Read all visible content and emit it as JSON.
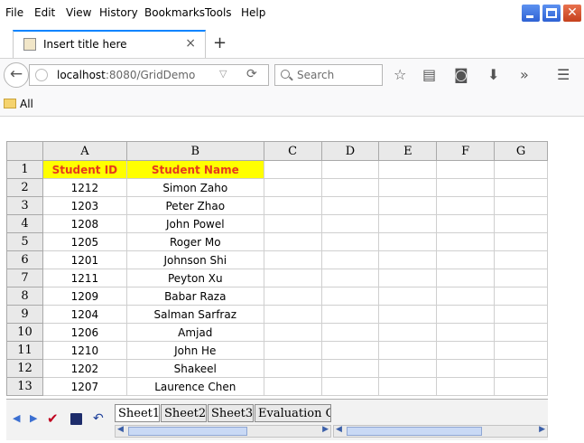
{
  "menu": {
    "items": [
      "File",
      "Edit",
      "View",
      "History",
      "Bookmarks",
      "Tools",
      "Help"
    ]
  },
  "tab": {
    "title": "Insert title here",
    "close_label": "×",
    "new_tab_label": "+"
  },
  "nav": {
    "url_host": "localhost",
    "url_rest": ":8080/GridDemo",
    "search_placeholder": "Search"
  },
  "bookmarks": {
    "items": [
      "All"
    ]
  },
  "grid": {
    "columns": [
      "A",
      "B",
      "C",
      "D",
      "E",
      "F",
      "G"
    ],
    "row_numbers": [
      "1",
      "2",
      "3",
      "4",
      "5",
      "6",
      "7",
      "8",
      "9",
      "10",
      "11",
      "12",
      "13"
    ],
    "header_row": [
      "Student ID",
      "Student Name"
    ],
    "rows": [
      [
        "1212",
        "Simon Zaho"
      ],
      [
        "1203",
        "Peter Zhao"
      ],
      [
        "1208",
        "John Powel"
      ],
      [
        "1205",
        "Roger Mo"
      ],
      [
        "1201",
        "Johnson Shi"
      ],
      [
        "1211",
        "Peyton Xu"
      ],
      [
        "1209",
        "Babar Raza"
      ],
      [
        "1204",
        "Salman Sarfraz"
      ],
      [
        "1206",
        "Amjad"
      ],
      [
        "1210",
        "John He"
      ],
      [
        "1202",
        "Shakeel"
      ],
      [
        "1207",
        "Laurence Chen"
      ]
    ],
    "header_fill": "#ffff00",
    "header_text_color": "#e63a1c"
  },
  "sheet_tabs": [
    "Sheet1",
    "Sheet2",
    "Sheet3",
    "Evaluation Co"
  ]
}
